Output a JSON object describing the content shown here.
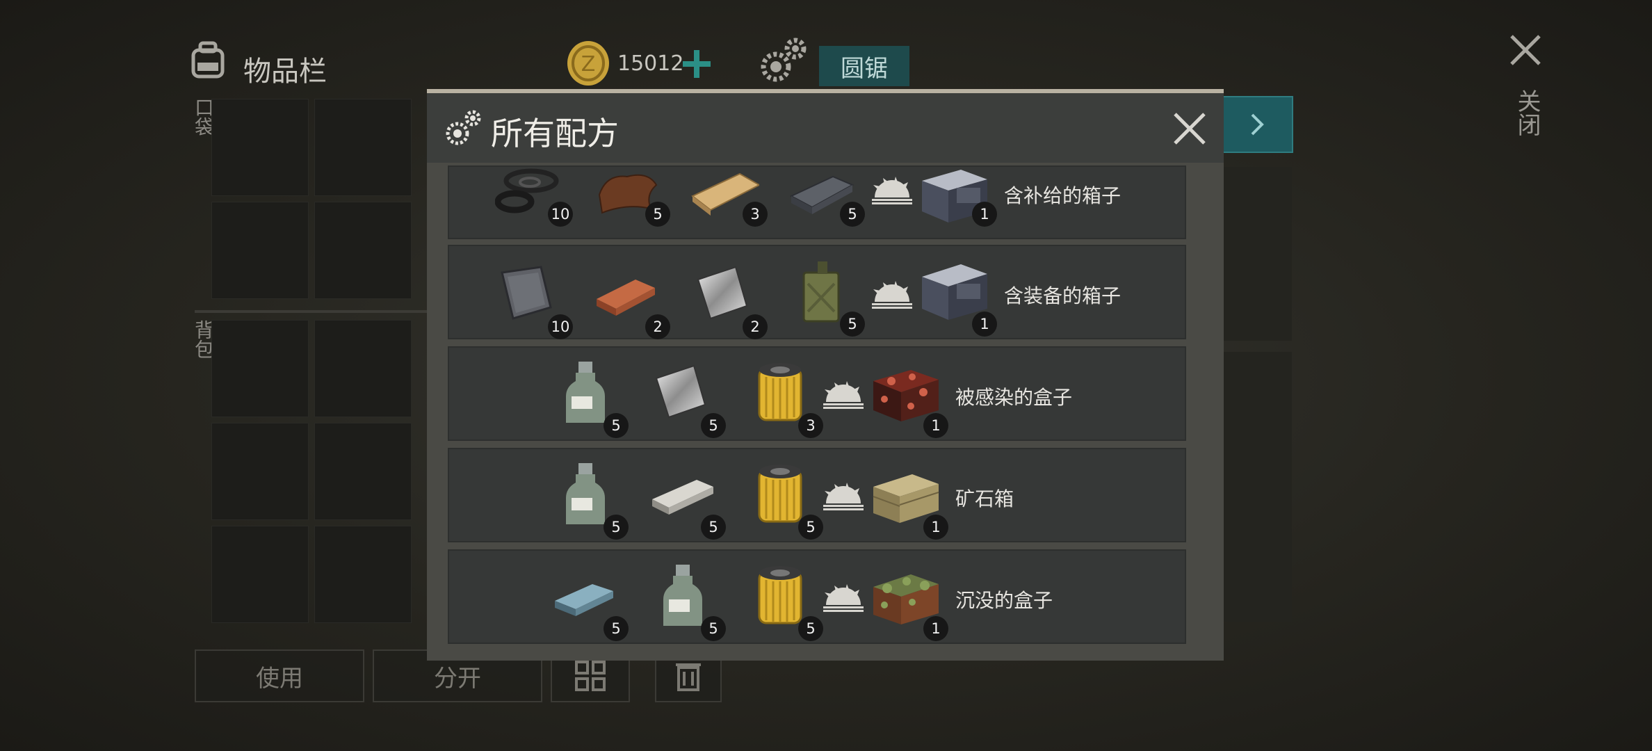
{
  "inventory": {
    "title": "物品栏",
    "pocket_label": "口袋",
    "backpack_label": "背包",
    "use_button": "使用",
    "split_button": "分开",
    "coins": "15012",
    "bench_name": "圆锯",
    "close_label": "关闭"
  },
  "modal": {
    "title": "所有配方",
    "recipes": [
      {
        "ingredients": [
          {
            "icon": "rubber-rings-icon",
            "count": "10"
          },
          {
            "icon": "leather-icon",
            "count": "5"
          },
          {
            "icon": "wood-plank-icon",
            "count": "3"
          },
          {
            "icon": "iron-ingot-icon",
            "count": "5"
          }
        ],
        "result": {
          "icon": "supply-crate-icon",
          "count": "1",
          "name": "含补给的箱子"
        }
      },
      {
        "ingredients": [
          {
            "icon": "metal-plate-icon",
            "count": "10"
          },
          {
            "icon": "copper-bar-icon",
            "count": "2"
          },
          {
            "icon": "aluminum-sheet-icon",
            "count": "2"
          },
          {
            "icon": "jerrycan-icon",
            "count": "5"
          }
        ],
        "result": {
          "icon": "equipment-crate-icon",
          "count": "1",
          "name": "含装备的箱子"
        }
      },
      {
        "ingredients": [
          {
            "icon": "chemical-bottle-icon",
            "count": "5"
          },
          {
            "icon": "aluminum-sheet-icon",
            "count": "5"
          },
          {
            "icon": "filter-icon",
            "count": "3"
          }
        ],
        "result": {
          "icon": "infected-box-icon",
          "count": "1",
          "name": "被感染的盒子"
        }
      },
      {
        "ingredients": [
          {
            "icon": "chemical-bottle-icon",
            "count": "5"
          },
          {
            "icon": "steel-bar-icon",
            "count": "5"
          },
          {
            "icon": "filter-icon",
            "count": "5"
          }
        ],
        "result": {
          "icon": "ore-crate-icon",
          "count": "1",
          "name": "矿石箱"
        }
      },
      {
        "ingredients": [
          {
            "icon": "titanium-ingot-icon",
            "count": "5"
          },
          {
            "icon": "chemical-bottle-icon",
            "count": "5"
          },
          {
            "icon": "filter-icon",
            "count": "5"
          }
        ],
        "result": {
          "icon": "sunken-box-icon",
          "count": "1",
          "name": "沉没的盒子"
        }
      }
    ]
  },
  "colors": {
    "accent_teal": "#1e5b60",
    "plus_green": "#2b8f86",
    "coin_gold": "#c8a23a"
  }
}
